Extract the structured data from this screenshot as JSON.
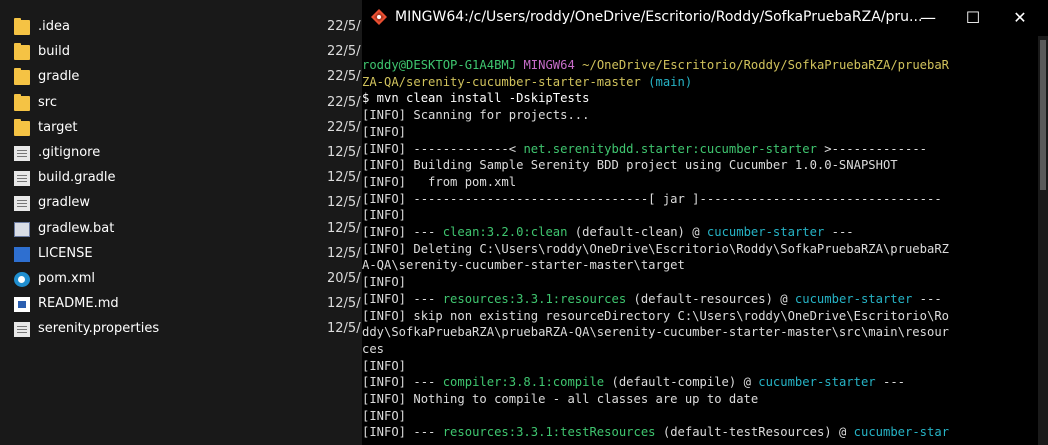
{
  "explorer": {
    "files": [
      {
        "name": ".idea",
        "date": "22/5/",
        "icon": "folder-icon"
      },
      {
        "name": "build",
        "date": "22/5/",
        "icon": "folder-icon"
      },
      {
        "name": "gradle",
        "date": "22/5/",
        "icon": "folder-icon"
      },
      {
        "name": "src",
        "date": "22/5/",
        "icon": "folder-icon"
      },
      {
        "name": "target",
        "date": "22/5/",
        "icon": "folder-icon"
      },
      {
        "name": ".gitignore",
        "date": "12/5/",
        "icon": "document-icon"
      },
      {
        "name": "build.gradle",
        "date": "12/5/",
        "icon": "document-icon"
      },
      {
        "name": "gradlew",
        "date": "12/5/",
        "icon": "document-icon"
      },
      {
        "name": "gradlew.bat",
        "date": "12/5/",
        "icon": "batch-file-icon"
      },
      {
        "name": "LICENSE",
        "date": "12/5/",
        "icon": "license-file-icon"
      },
      {
        "name": "pom.xml",
        "date": "20/5/",
        "icon": "xml-file-icon"
      },
      {
        "name": "README.md",
        "date": "12/5/",
        "icon": "markdown-file-icon"
      },
      {
        "name": "serenity.properties",
        "date": "12/5/",
        "icon": "document-icon"
      }
    ]
  },
  "terminal": {
    "title": "MINGW64:/c/Users/roddy/OneDrive/Escritorio/Roddy/SofkaPruebaRZA/pru...",
    "controls": {
      "minimize": "—",
      "maximize": "☐",
      "close": "✕"
    },
    "lines": [
      [
        {
          "t": "roddy@DESKTOP-G1A4BMJ ",
          "c": "g"
        },
        {
          "t": "MINGW64 ",
          "c": "m"
        },
        {
          "t": "~/OneDrive/Escritorio/Roddy/SofkaPruebaRZA/pruebaR",
          "c": "y"
        }
      ],
      [
        {
          "t": "ZA-QA/serenity-cucumber-starter-master",
          "c": "y"
        },
        {
          "t": " (main)",
          "c": "c"
        }
      ],
      [
        {
          "t": "$ mvn clean install -DskipTests",
          "c": "w"
        }
      ],
      [
        {
          "t": "[INFO] Scanning for projects..."
        }
      ],
      [
        {
          "t": "[INFO]"
        }
      ],
      [
        {
          "t": "[INFO] -------------< "
        },
        {
          "t": "net.serenitybdd.starter:cucumber-starter",
          "c": "g"
        },
        {
          "t": " >-------------"
        }
      ],
      [
        {
          "t": "[INFO] Building Sample Serenity BDD project using Cucumber 1.0.0-SNAPSHOT"
        }
      ],
      [
        {
          "t": "[INFO]   from pom.xml"
        }
      ],
      [
        {
          "t": "[INFO] --------------------------------[ jar ]---------------------------------"
        }
      ],
      [
        {
          "t": "[INFO]"
        }
      ],
      [
        {
          "t": "[INFO] --- "
        },
        {
          "t": "clean:3.2.0:clean",
          "c": "g"
        },
        {
          "t": " (default-clean) @ "
        },
        {
          "t": "cucumber-starter",
          "c": "c"
        },
        {
          "t": " ---"
        }
      ],
      [
        {
          "t": "[INFO] Deleting C:\\Users\\roddy\\OneDrive\\Escritorio\\Roddy\\SofkaPruebaRZA\\pruebaRZ"
        }
      ],
      [
        {
          "t": "A-QA\\serenity-cucumber-starter-master\\target"
        }
      ],
      [
        {
          "t": "[INFO]"
        }
      ],
      [
        {
          "t": "[INFO] --- "
        },
        {
          "t": "resources:3.3.1:resources",
          "c": "g"
        },
        {
          "t": " (default-resources) @ "
        },
        {
          "t": "cucumber-starter",
          "c": "c"
        },
        {
          "t": " ---"
        }
      ],
      [
        {
          "t": "[INFO] skip non existing resourceDirectory C:\\Users\\roddy\\OneDrive\\Escritorio\\Ro"
        }
      ],
      [
        {
          "t": "ddy\\SofkaPruebaRZA\\pruebaRZA-QA\\serenity-cucumber-starter-master\\src\\main\\resour"
        }
      ],
      [
        {
          "t": "ces"
        }
      ],
      [
        {
          "t": "[INFO]"
        }
      ],
      [
        {
          "t": "[INFO] --- "
        },
        {
          "t": "compiler:3.8.1:compile",
          "c": "g"
        },
        {
          "t": " (default-compile) @ "
        },
        {
          "t": "cucumber-starter",
          "c": "c"
        },
        {
          "t": " ---"
        }
      ],
      [
        {
          "t": "[INFO] Nothing to compile - all classes are up to date"
        }
      ],
      [
        {
          "t": "[INFO]"
        }
      ],
      [
        {
          "t": "[INFO] --- "
        },
        {
          "t": "resources:3.3.1:testResources",
          "c": "g"
        },
        {
          "t": " (default-testResources) @ "
        },
        {
          "t": "cucumber-star",
          "c": "c"
        }
      ]
    ]
  }
}
